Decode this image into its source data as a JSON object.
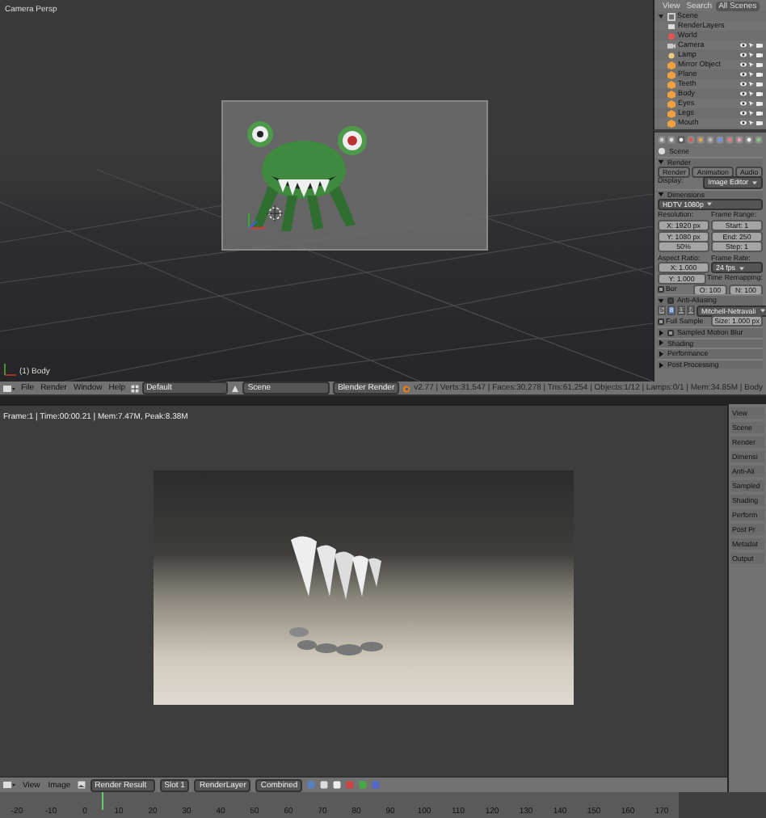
{
  "viewport": {
    "label": "Camera Persp",
    "object_label": "(1) Body"
  },
  "outliner": {
    "tabs": [
      {
        "label": "View",
        "selected": false
      },
      {
        "label": "Search",
        "selected": false
      },
      {
        "label": "All Scenes",
        "selected": true
      }
    ],
    "items": [
      {
        "name": "Scene",
        "kind": "scene",
        "children": [
          {
            "name": "RenderLayers",
            "kind": "layers"
          },
          {
            "name": "World",
            "kind": "world"
          },
          {
            "name": "Camera",
            "kind": "camera"
          },
          {
            "name": "Lamp",
            "kind": "lamp"
          },
          {
            "name": "Mirror Object",
            "kind": "mesh"
          },
          {
            "name": "Plane",
            "kind": "mesh"
          },
          {
            "name": "Teeth",
            "kind": "mesh"
          },
          {
            "name": "Body",
            "kind": "mesh"
          },
          {
            "name": "Eyes",
            "kind": "mesh"
          },
          {
            "name": "Legs",
            "kind": "mesh"
          },
          {
            "name": "Mouth",
            "kind": "mesh"
          }
        ]
      }
    ]
  },
  "properties": {
    "rows": [
      {
        "kind": "context",
        "text": "Scene"
      },
      {
        "kind": "panel",
        "text": "Render",
        "expanded": true
      },
      {
        "kind": "buttons",
        "items": [
          "Render",
          "Animation",
          "Audio"
        ]
      },
      {
        "kind": "columns",
        "cells": [
          {
            "kind": "label",
            "text": "Display:"
          },
          {
            "kind": "select",
            "text": "Image Editor"
          }
        ]
      },
      {
        "kind": "panel",
        "text": "Dimensions",
        "expanded": true
      },
      {
        "kind": "columns",
        "cells": [
          {
            "kind": "select",
            "text": "HDTV 1080p"
          }
        ]
      },
      {
        "kind": "columns",
        "cells": [
          {
            "kind": "label",
            "text": "Resolution:"
          },
          {
            "kind": "label",
            "text": "Frame Range:"
          }
        ]
      },
      {
        "kind": "columns",
        "cells": [
          {
            "kind": "field",
            "text": "X: 1920 px"
          },
          {
            "kind": "field",
            "text": "Start: 1"
          }
        ]
      },
      {
        "kind": "columns",
        "cells": [
          {
            "kind": "field",
            "text": "Y: 1080 px"
          },
          {
            "kind": "field",
            "text": "End: 250"
          }
        ]
      },
      {
        "kind": "columns",
        "cells": [
          {
            "kind": "field",
            "text": "50%"
          },
          {
            "kind": "field",
            "text": "Step: 1"
          }
        ]
      },
      {
        "kind": "columns",
        "cells": [
          {
            "kind": "label",
            "text": "Aspect Ratio:"
          },
          {
            "kind": "label",
            "text": "Frame Rate:"
          }
        ]
      },
      {
        "kind": "columns",
        "cells": [
          {
            "kind": "field",
            "text": "X: 1.000"
          },
          {
            "kind": "select",
            "text": "24 fps"
          }
        ]
      },
      {
        "kind": "columns",
        "cells": [
          {
            "kind": "field",
            "text": "Y: 1.000"
          },
          {
            "kind": "label",
            "text": "Time Remapping:"
          }
        ]
      },
      {
        "kind": "columns",
        "cells": [
          {
            "kind": "check",
            "text": "Bor",
            "checked": false
          },
          {
            "kind": "field",
            "text": "O: 100"
          },
          {
            "kind": "field",
            "text": "N: 100"
          }
        ]
      },
      {
        "kind": "panel",
        "text": "Anti-Aliasing",
        "expanded": true,
        "checked": true
      },
      {
        "kind": "columns",
        "cells": [
          {
            "kind": "toggle",
            "text": "5",
            "selected": false
          },
          {
            "kind": "toggle",
            "text": "8",
            "selected": true
          },
          {
            "kind": "toggle",
            "text": "11",
            "selected": false
          },
          {
            "kind": "toggle",
            "text": "16",
            "selected": false
          },
          {
            "kind": "select",
            "text": "Mitchell-Netravali"
          }
        ]
      },
      {
        "kind": "columns",
        "cells": [
          {
            "kind": "check",
            "text": "Full Sample",
            "checked": false
          },
          {
            "kind": "field",
            "text": "Size: 1.000 px"
          }
        ]
      },
      {
        "kind": "panel",
        "text": "Sampled Motion Blur",
        "expanded": false,
        "checked": false
      },
      {
        "kind": "panel",
        "text": "Shading",
        "expanded": false
      },
      {
        "kind": "panel",
        "text": "Performance",
        "expanded": false
      },
      {
        "kind": "panel",
        "text": "Post Processing",
        "expanded": false
      }
    ]
  },
  "header": {
    "menus": [
      "File",
      "Render",
      "Window",
      "Help"
    ],
    "layout": "Default",
    "scene": "Scene",
    "engine": "Blender Render",
    "stats": "v2.77 | Verts:31,547 | Faces:30,278 | Tris:61,254 | Objects:1/12 | Lamps:0/1 | Mem:34.85M | Body"
  },
  "image_editor": {
    "info": "Frame:1 | Time:00:00.21 | Mem:7.47M, Peak:8.38M"
  },
  "side_panel": {
    "items": [
      "View",
      "Scene",
      "Render",
      "Dimensi",
      "Anti-Ali",
      "Sampled",
      "Shading",
      "Perform",
      "Post Pr",
      "Metadat",
      "Output"
    ]
  },
  "image_bar": {
    "menus": [
      "View",
      "Image"
    ],
    "image": "Render Result",
    "slot": "Slot 1",
    "layer": "RenderLayer",
    "pass": "Combined"
  },
  "timeline": {
    "ticks": [
      "-20",
      "-10",
      "0",
      "10",
      "20",
      "30",
      "40",
      "50",
      "60",
      "70",
      "80",
      "90",
      "100",
      "110",
      "120",
      "130",
      "140",
      "150",
      "160",
      "170"
    ]
  }
}
